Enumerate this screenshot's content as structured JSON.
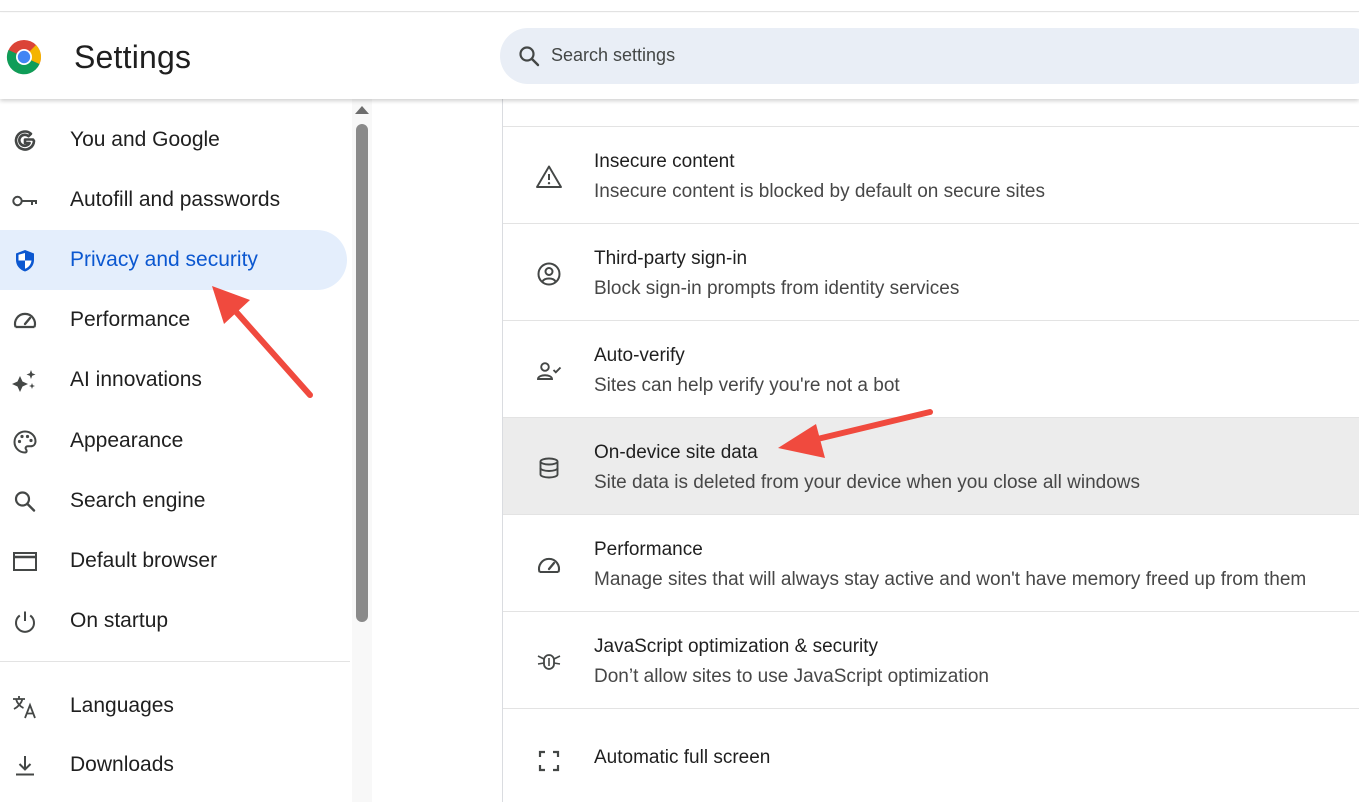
{
  "app": {
    "title": "Settings"
  },
  "search": {
    "placeholder": "Search settings"
  },
  "sidebar": {
    "items": [
      {
        "label": "You and Google",
        "icon": "google-g-icon"
      },
      {
        "label": "Autofill and passwords",
        "icon": "key-icon"
      },
      {
        "label": "Privacy and security",
        "icon": "shield-icon",
        "active": true
      },
      {
        "label": "Performance",
        "icon": "speedometer-icon"
      },
      {
        "label": "AI innovations",
        "icon": "sparkle-icon"
      },
      {
        "label": "Appearance",
        "icon": "palette-icon"
      },
      {
        "label": "Search engine",
        "icon": "search-icon"
      },
      {
        "label": "Default browser",
        "icon": "browser-window-icon"
      },
      {
        "label": "On startup",
        "icon": "power-icon"
      },
      {
        "label": "Languages",
        "icon": "translate-icon"
      },
      {
        "label": "Downloads",
        "icon": "download-icon"
      }
    ]
  },
  "content": {
    "rows": [
      {
        "title": "Insecure content",
        "subtitle": "Insecure content is blocked by default on secure sites",
        "icon": "warning-icon"
      },
      {
        "title": "Third-party sign-in",
        "subtitle": "Block sign-in prompts from identity services",
        "icon": "account-circle-icon"
      },
      {
        "title": "Auto-verify",
        "subtitle": "Sites can help verify you're not a bot",
        "icon": "person-check-icon"
      },
      {
        "title": "On-device site data",
        "subtitle": "Site data is deleted from your device when you close all windows",
        "icon": "database-icon",
        "highlighted": true
      },
      {
        "title": "Performance",
        "subtitle": "Manage sites that will always stay active and won't have memory freed up from them",
        "icon": "speedometer-icon"
      },
      {
        "title": "JavaScript optimization & security",
        "subtitle": "Don’t allow sites to use JavaScript optimization",
        "icon": "javascript-icon"
      },
      {
        "title": "Automatic full screen",
        "subtitle": "",
        "icon": "fullscreen-icon"
      }
    ]
  },
  "colors": {
    "accent": "#0b57d0",
    "active_bg": "#e4eefc",
    "highlight_row": "#ececec",
    "annotation_arrow": "#f04a3e"
  }
}
